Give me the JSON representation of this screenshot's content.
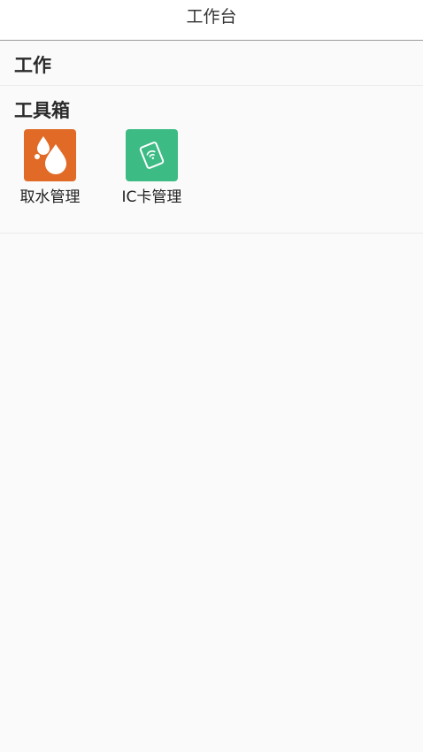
{
  "header": {
    "title": "工作台"
  },
  "sections": {
    "work": {
      "title": "工作"
    },
    "toolbox": {
      "title": "工具箱",
      "items": [
        {
          "label": "取水管理",
          "icon": "water-drops-icon",
          "color": "#e06a26"
        },
        {
          "label": "IC卡管理",
          "icon": "ic-card-icon",
          "color": "#3dbb84"
        }
      ]
    }
  }
}
